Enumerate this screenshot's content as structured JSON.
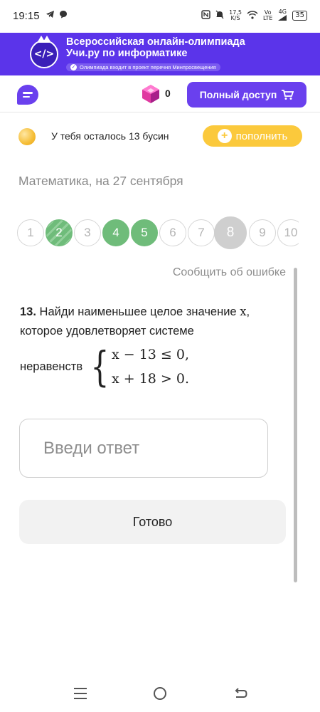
{
  "status_bar": {
    "time": "19:15",
    "speed_value": "17,5",
    "speed_unit": "K/S",
    "network_top": "Vo",
    "network_bottom": "LTE",
    "signal_label": "4G",
    "battery": "35"
  },
  "banner": {
    "title_line1": "Всероссийская онлайн-олимпиада",
    "title_line2": "Учи.ру по информатике",
    "subtitle": "Олимпиада входит в проект перечня Минпросвещения",
    "logo_text": "</>"
  },
  "header": {
    "gem_count": "0",
    "full_access_label": "Полный доступ"
  },
  "beads": {
    "text": "У тебя осталось 13 бусин",
    "topup_label": "пополнить"
  },
  "subject": "Математика, на 27 сентября",
  "question_nav": [
    {
      "label": "1",
      "state": "empty"
    },
    {
      "label": "2",
      "state": "striped"
    },
    {
      "label": "3",
      "state": "empty"
    },
    {
      "label": "4",
      "state": "correct"
    },
    {
      "label": "5",
      "state": "correct"
    },
    {
      "label": "6",
      "state": "empty"
    },
    {
      "label": "7",
      "state": "empty"
    },
    {
      "label": "8",
      "state": "current"
    },
    {
      "label": "9",
      "state": "empty"
    },
    {
      "label": "10",
      "state": "empty"
    }
  ],
  "report_error": "Сообщить об ошибке",
  "question": {
    "number": "13.",
    "text_part1": "Найди наименьшее целое значение",
    "variable": "x",
    "text_part2": ",",
    "text_line2": "которое удовлетворяет системе",
    "text_line3": "неравенств",
    "equation1": "x − 13 ≤ 0,",
    "equation2": "x + 18 > 0."
  },
  "answer": {
    "placeholder": "Введи ответ"
  },
  "done_label": "Готово",
  "colors": {
    "banner": "#5b34ea",
    "accent": "#6a40ee",
    "correct": "#6fbc7a",
    "topup": "#fbc93c"
  }
}
